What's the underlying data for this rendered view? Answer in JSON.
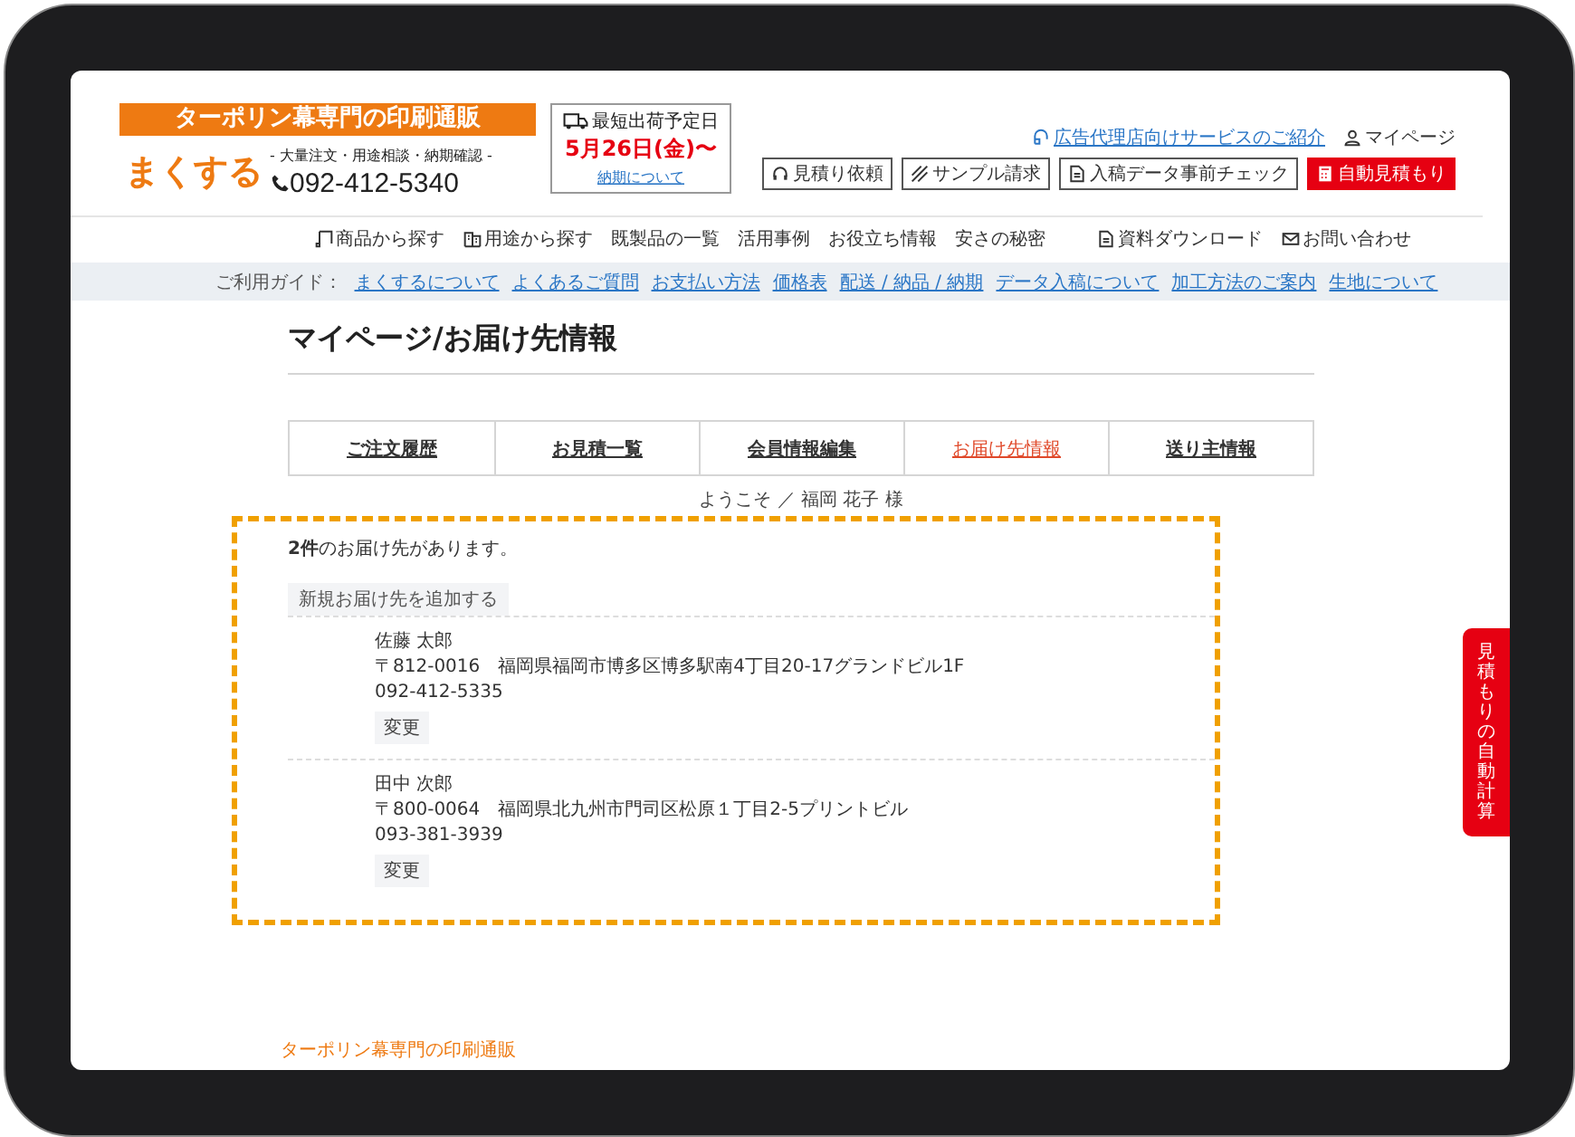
{
  "header": {
    "banner": "ターポリン幕専門の印刷通販",
    "logo": "まくする",
    "subtitle": "- 大量注文・用途相談・納期確認 -",
    "phone": "092-412-5340",
    "shipping": {
      "label": "最短出荷予定日",
      "date": "5月26日(金)〜",
      "link": "納期について"
    },
    "top_links": [
      "広告代理店向けサービスのご紹介",
      "マイページ"
    ],
    "buttons": [
      {
        "label": "見積り依頼",
        "kind": "outline"
      },
      {
        "label": "サンプル請求",
        "kind": "outline"
      },
      {
        "label": "入稿データ事前チェック",
        "kind": "outline"
      },
      {
        "label": "自動見積もり",
        "kind": "primary"
      }
    ]
  },
  "nav": [
    "商品から探す",
    "用途から探す",
    "既製品の一覧",
    "活用事例",
    "お役立ち情報",
    "安さの秘密",
    "資料ダウンロード",
    "お問い合わせ"
  ],
  "guide": {
    "label": "ご利用ガイド：",
    "links": [
      "まくするについて",
      "よくあるご質問",
      "お支払い方法",
      "価格表",
      "配送 / 納品 / 納期",
      "データ入稿について",
      "加工方法のご案内",
      "生地について"
    ]
  },
  "page_title": "マイページ/お届け先情報",
  "tabs": [
    {
      "label": "ご注文履歴",
      "selected": false
    },
    {
      "label": "お見積一覧",
      "selected": false
    },
    {
      "label": "会員情報編集",
      "selected": false
    },
    {
      "label": "お届け先情報",
      "selected": true
    },
    {
      "label": "送り主情報",
      "selected": false
    }
  ],
  "welcome": "ようこそ ／ 福岡 花子 様",
  "count_text": "**2件**のお届け先があります。",
  "add_button": "新規お届け先を追加する",
  "addresses": [
    {
      "name": "佐藤 太郎",
      "address": "〒812-0016　福岡県福岡市博多区博多駅南4丁目20-17グランドビル1F",
      "phone": "092-412-5335",
      "button": "変更"
    },
    {
      "name": "田中 次郎",
      "address": "〒800-0064　福岡県北九州市門司区松原１丁目2-5プリントビル",
      "phone": "093-381-3939",
      "button": "変更"
    }
  ],
  "side_tab": "見積もりの自動計算",
  "footer": {
    "banner": "ターポリン幕専門の印刷通販"
  }
}
